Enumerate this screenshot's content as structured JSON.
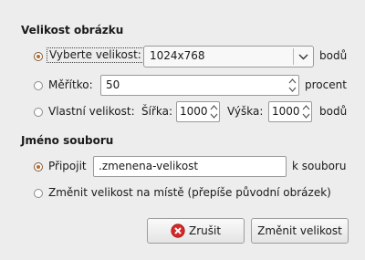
{
  "size_section": {
    "title": "Velikost obrázku",
    "option_preset": {
      "label": "Vyberte velikost:",
      "selected_value": "1024x768",
      "suffix": "bodů",
      "checked": true
    },
    "option_scale": {
      "label": "Měřítko:",
      "value": "50",
      "suffix": "procent",
      "checked": false
    },
    "option_custom": {
      "label": "Vlastní velikost:",
      "width_label": "Šířka:",
      "width_value": "1000",
      "height_label": "Výška:",
      "height_value": "1000",
      "suffix": "bodů",
      "checked": false
    }
  },
  "filename_section": {
    "title": "Jméno souboru",
    "option_append": {
      "label": "Připojit",
      "value": ".zmenena-velikost",
      "suffix": "k souboru",
      "checked": true
    },
    "option_inplace": {
      "label": "Změnit velikost na místě (přepíše původní obrázek)",
      "checked": false
    }
  },
  "buttons": {
    "cancel_label": "Zrušit",
    "resize_label": "Změnit velikost"
  },
  "colors": {
    "window_bg": "#ededed",
    "radio_accent": "#c26a1f",
    "cancel_icon": "#d62828"
  }
}
